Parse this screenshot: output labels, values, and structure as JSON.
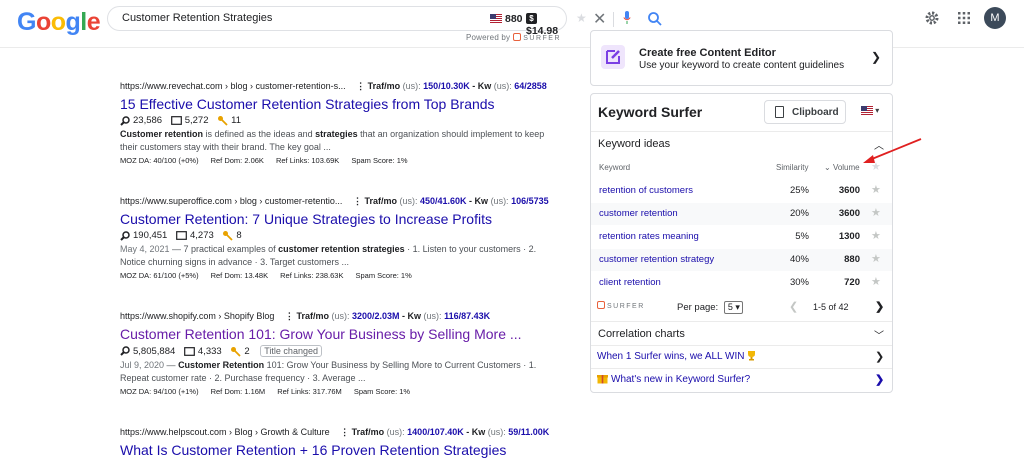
{
  "header": {
    "logo": "Google",
    "search_query": "Customer Retention Strategies",
    "volume": "880",
    "cpc": "$14.98",
    "powered_by": "Powered by",
    "surfer": "SURFER",
    "avatar_initial": "M"
  },
  "results": [
    {
      "url": "https://www.revechat.com › blog › customer-retention-s...",
      "traf_label": "Traf/mo",
      "traf_country": "(us):",
      "traf_values": "150/10.30K",
      "kw_label": "Kw",
      "kw_country": "(us):",
      "kw_values": "64/2858",
      "title": "15 Effective Customer Retention Strategies from Top Brands",
      "stat_words": "23,586",
      "stat_pages": "5,272",
      "stat_keys": "11",
      "snippet_bold1": "Customer retention",
      "snippet_mid1": " is defined as the ideas and ",
      "snippet_bold2": "strategies",
      "snippet_rest": " that an organization should implement to keep their customers stay with their brand. The key goal ...",
      "moz_da": "MOZ DA: 40/100 (+0%)",
      "ref_dom": "Ref Dom: 2.06K",
      "ref_links": "Ref Links: 103.69K",
      "spam": "Spam Score: 1%"
    },
    {
      "url": "https://www.superoffice.com › blog › customer-retentio...",
      "traf_label": "Traf/mo",
      "traf_country": "(us):",
      "traf_values": "450/41.60K",
      "kw_label": "Kw",
      "kw_country": "(us):",
      "kw_values": "106/5735",
      "title": "Customer Retention: 7 Unique Strategies to Increase Profits",
      "stat_words": "190,451",
      "stat_pages": "4,273",
      "stat_keys": "8",
      "snippet_date": "May 4, 2021",
      "snippet_lead": " — 7 practical examples of ",
      "snippet_bold1": "customer retention strategies",
      "snippet_rest": " · 1. Listen to your customers · 2. Notice churning signs in advance · 3. Target customers ...",
      "moz_da": "MOZ DA: 61/100 (+5%)",
      "ref_dom": "Ref Dom: 13.48K",
      "ref_links": "Ref Links: 238.63K",
      "spam": "Spam Score: 1%"
    },
    {
      "url": "https://www.shopify.com › Shopify Blog",
      "traf_label": "Traf/mo",
      "traf_country": "(us):",
      "traf_values": "3200/2.03M",
      "kw_label": "Kw",
      "kw_country": "(us):",
      "kw_values": "116/87.43K",
      "title": "Customer Retention 101: Grow Your Business by Selling More ...",
      "stat_words": "5,805,884",
      "stat_pages": "4,333",
      "stat_keys": "2",
      "badge": "Title changed",
      "snippet_date": "Jul 9, 2020",
      "snippet_lead": " — ",
      "snippet_bold1": "Customer Retention",
      "snippet_rest": " 101: Grow Your Business by Selling More to Current Customers · 1. Repeat customer rate · 2. Purchase frequency · 3. Average ...",
      "moz_da": "MOZ DA: 94/100 (+1%)",
      "ref_dom": "Ref Dom: 1.16M",
      "ref_links": "Ref Links: 317.76M",
      "spam": "Spam Score: 1%"
    },
    {
      "url": "https://www.helpscout.com › Blog › Growth & Culture",
      "traf_label": "Traf/mo",
      "traf_country": "(us):",
      "traf_values": "1400/107.40K",
      "kw_label": "Kw",
      "kw_country": "(us):",
      "kw_values": "59/11.00K",
      "title": "What Is Customer Retention + 16 Proven Retention Strategies"
    }
  ],
  "content_editor": {
    "title": "Create free Content Editor",
    "subtitle": "Use your keyword to create content guidelines"
  },
  "keyword_surfer": {
    "title": "Keyword Surfer",
    "clipboard": "Clipboard",
    "keyword_ideas": "Keyword ideas",
    "col_keyword": "Keyword",
    "col_similarity": "Similarity",
    "col_volume": "Volume",
    "rows": [
      {
        "keyword": "retention of customers",
        "similarity": "25%",
        "volume": "3600"
      },
      {
        "keyword": "customer retention",
        "similarity": "20%",
        "volume": "3600"
      },
      {
        "keyword": "retention rates meaning",
        "similarity": "5%",
        "volume": "1300"
      },
      {
        "keyword": "customer retention strategy",
        "similarity": "40%",
        "volume": "880"
      },
      {
        "keyword": "client retention",
        "similarity": "30%",
        "volume": "720"
      }
    ],
    "surfer": "SURFER",
    "per_page_label": "Per page:",
    "per_page_value": "5",
    "pagination": "1-5 of 42",
    "correlation_charts": "Correlation charts",
    "link1": "When 1 Surfer wins, we ALL WIN",
    "link2": "What's new in Keyword Surfer?"
  },
  "colors": {
    "link": "#1a0dab",
    "visited": "#681da8",
    "arrow": "#e02020"
  }
}
